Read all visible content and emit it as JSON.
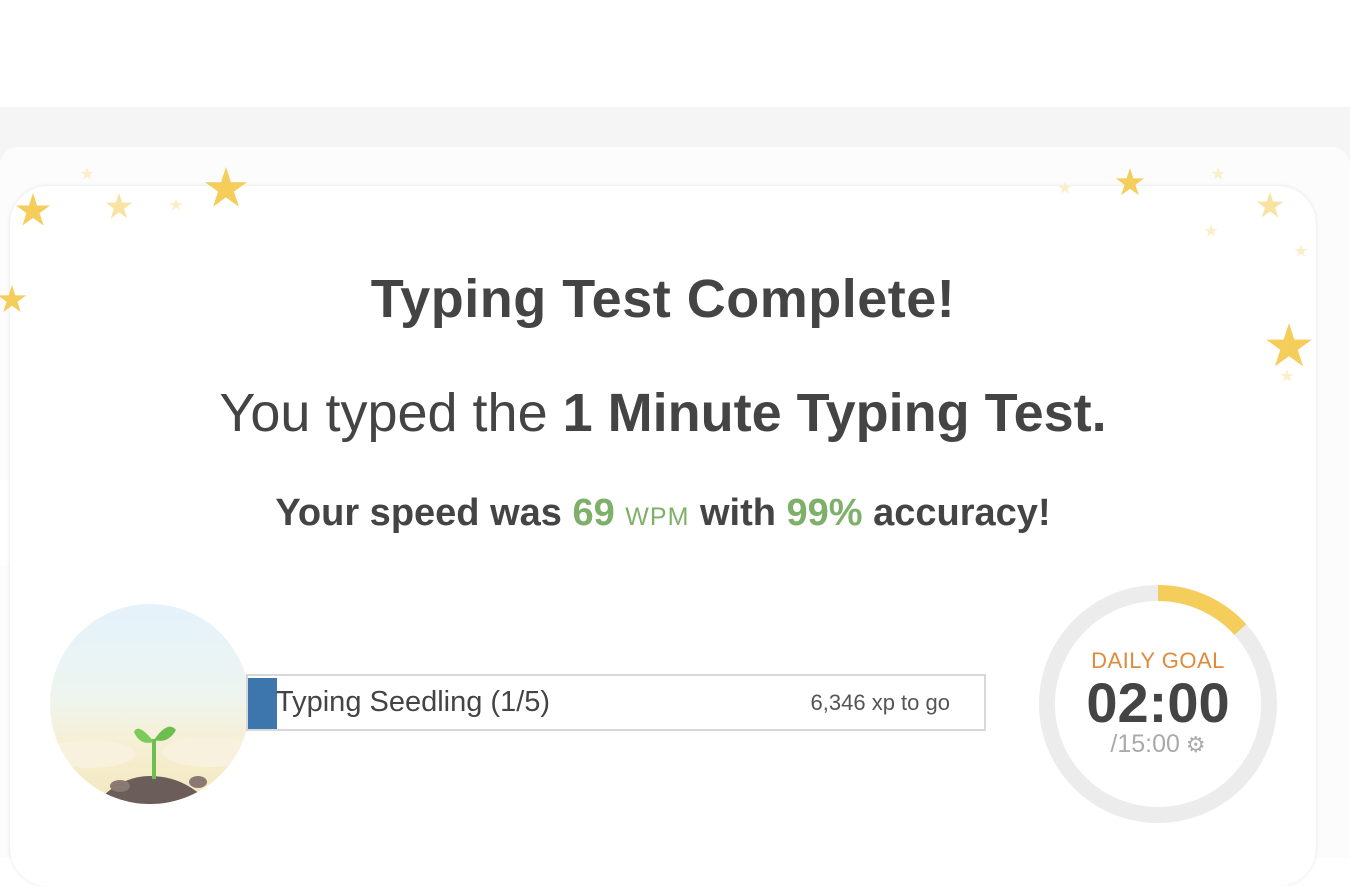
{
  "results": {
    "title": "Typing Test Complete!",
    "subtitle_prefix": "You typed the ",
    "test_name": "1 Minute Typing Test.",
    "speed_prefix": "Your speed was ",
    "wpm": "69",
    "wpm_unit": "WPM",
    "speed_middle": " with ",
    "accuracy": "99%",
    "speed_suffix": " accuracy!"
  },
  "level": {
    "name": "Typing Seedling (1/5)",
    "xp_to_go": "6,346 xp to go",
    "progress_fraction": 0.04
  },
  "daily_goal": {
    "label": "DAILY GOAL",
    "time": "02:00",
    "total": "/15:00",
    "progress_fraction": 0.133,
    "ring_color": "#f5cd5b"
  },
  "colors": {
    "accent_green": "#7fb06a",
    "level_fill": "#3d76ad",
    "goal_label": "#e08a3c",
    "star": "#f5cd5b"
  },
  "icons": {
    "settings": "gear-icon",
    "avatar": "seedling-icon",
    "decoration": "star-icon"
  }
}
